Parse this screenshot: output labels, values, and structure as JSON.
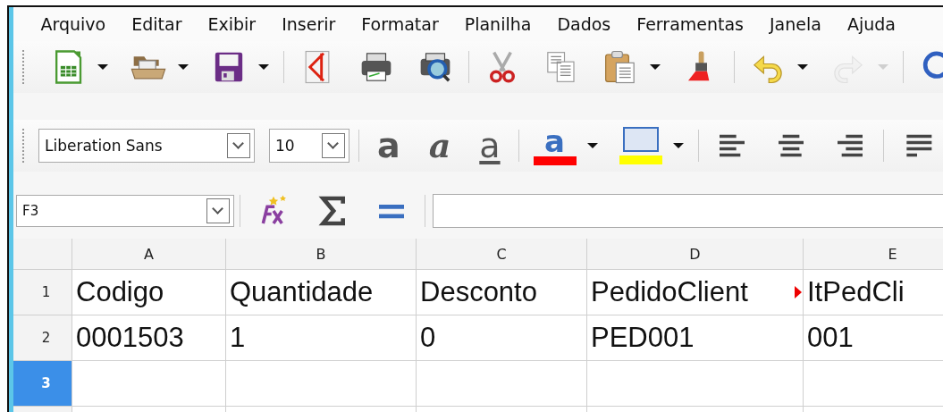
{
  "menu": [
    {
      "label": "Arquivo"
    },
    {
      "label": "Editar"
    },
    {
      "label": "Exibir"
    },
    {
      "label": "Inserir"
    },
    {
      "label": "Formatar"
    },
    {
      "label": "Planilha"
    },
    {
      "label": "Dados"
    },
    {
      "label": "Ferramentas"
    },
    {
      "label": "Janela"
    },
    {
      "label": "Ajuda"
    }
  ],
  "standard_toolbar": [
    {
      "kind": "new-sheet",
      "dropdown": true,
      "disabled": false
    },
    {
      "kind": "folder",
      "dropdown": true,
      "disabled": false
    },
    {
      "kind": "save",
      "dropdown": true,
      "disabled": false
    },
    {
      "kind": "separator"
    },
    {
      "kind": "pdf",
      "dropdown": false,
      "disabled": false
    },
    {
      "kind": "print",
      "dropdown": false,
      "disabled": false
    },
    {
      "kind": "preview",
      "dropdown": false,
      "disabled": false
    },
    {
      "kind": "separator"
    },
    {
      "kind": "cut",
      "dropdown": false,
      "disabled": false
    },
    {
      "kind": "copy",
      "dropdown": false,
      "disabled": false
    },
    {
      "kind": "paste",
      "dropdown": true,
      "disabled": false
    },
    {
      "kind": "brush",
      "dropdown": false,
      "disabled": false
    },
    {
      "kind": "separator"
    },
    {
      "kind": "undo",
      "dropdown": true,
      "disabled": false
    },
    {
      "kind": "redo",
      "dropdown": true,
      "disabled": true
    },
    {
      "kind": "separator"
    },
    {
      "kind": "find",
      "disabled": false
    }
  ],
  "formatting_toolbar": {
    "font_name": "Liberation Sans",
    "font_size": "10",
    "tools": [
      {
        "kind": "separator"
      },
      {
        "kind": "bold",
        "dropdown": false,
        "glyph": "a"
      },
      {
        "kind": "italic",
        "dropdown": false,
        "glyph": "a"
      },
      {
        "kind": "underline",
        "dropdown": false,
        "glyph": "a"
      },
      {
        "kind": "separator"
      },
      {
        "kind": "font-color",
        "dropdown": true,
        "color": "#ff0000",
        "glyph": "a"
      },
      {
        "kind": "highlight",
        "dropdown": true,
        "color": "#ffff00"
      },
      {
        "kind": "separator"
      },
      {
        "kind": "align-left",
        "dropdown": false
      },
      {
        "kind": "align-center",
        "dropdown": false
      },
      {
        "kind": "align-right",
        "dropdown": false
      },
      {
        "kind": "separator"
      },
      {
        "kind": "justify",
        "dropdown": false
      }
    ]
  },
  "formula_bar": {
    "name_box": "F3",
    "tools": [
      {
        "kind": "wizard"
      },
      {
        "kind": "sum"
      },
      {
        "kind": "equals"
      }
    ]
  },
  "sheet": {
    "columns": [
      {
        "label": "A"
      },
      {
        "label": "B"
      },
      {
        "label": "C"
      },
      {
        "label": "D"
      },
      {
        "label": "E"
      }
    ],
    "rows": [
      {
        "number": "1",
        "selected": false,
        "cells": [
          {
            "text": "Codigo"
          },
          {
            "text": "Quantidade"
          },
          {
            "text": "Desconto"
          },
          {
            "text": "PedidoClient",
            "overflow": true
          },
          {
            "text": "ItPedCli"
          }
        ]
      },
      {
        "number": "2",
        "selected": false,
        "cells": [
          {
            "text": "0001503"
          },
          {
            "text": "1"
          },
          {
            "text": "0"
          },
          {
            "text": "PED001"
          },
          {
            "text": "001"
          }
        ]
      },
      {
        "number": "3",
        "selected": true,
        "cells": [
          {},
          {},
          {},
          {},
          {}
        ]
      }
    ]
  }
}
